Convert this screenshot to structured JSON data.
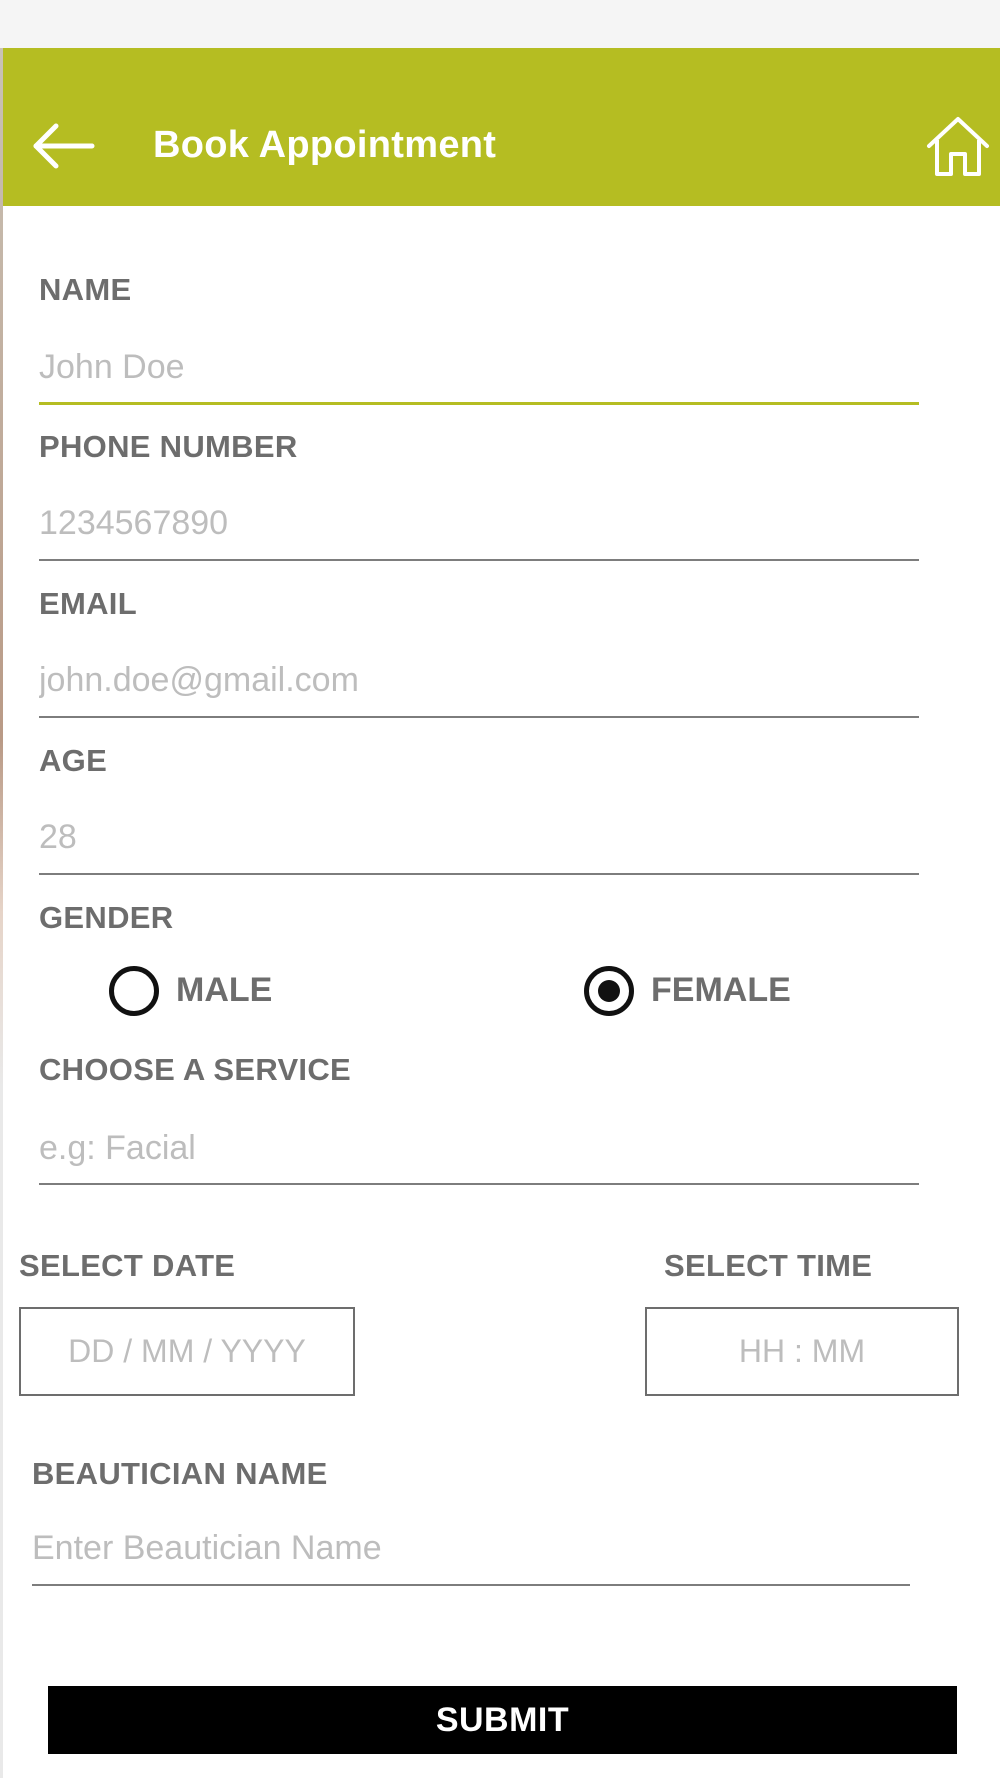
{
  "header": {
    "title": "Book Appointment",
    "back_icon": "arrow-left-icon",
    "home_icon": "home-icon",
    "bar_color": "#b5bd22"
  },
  "form": {
    "name": {
      "label": "NAME",
      "placeholder": "John Doe"
    },
    "phone": {
      "label": "PHONE NUMBER",
      "placeholder": "1234567890"
    },
    "email": {
      "label": "EMAIL",
      "placeholder": "john.doe@gmail.com"
    },
    "age": {
      "label": "AGE",
      "placeholder": "28"
    },
    "gender": {
      "label": "GENDER",
      "options": [
        {
          "label": "MALE",
          "selected": false
        },
        {
          "label": "FEMALE",
          "selected": true
        }
      ]
    },
    "service": {
      "label": "CHOOSE A SERVICE",
      "placeholder": "e.g: Facial"
    },
    "date": {
      "label": "SELECT DATE",
      "placeholder": "DD / MM / YYYY"
    },
    "time": {
      "label": "SELECT TIME",
      "placeholder": "HH : MM"
    },
    "beautician": {
      "label": "BEAUTICIAN NAME",
      "placeholder": "Enter Beautician Name"
    }
  },
  "submit_label": "SUBMIT"
}
